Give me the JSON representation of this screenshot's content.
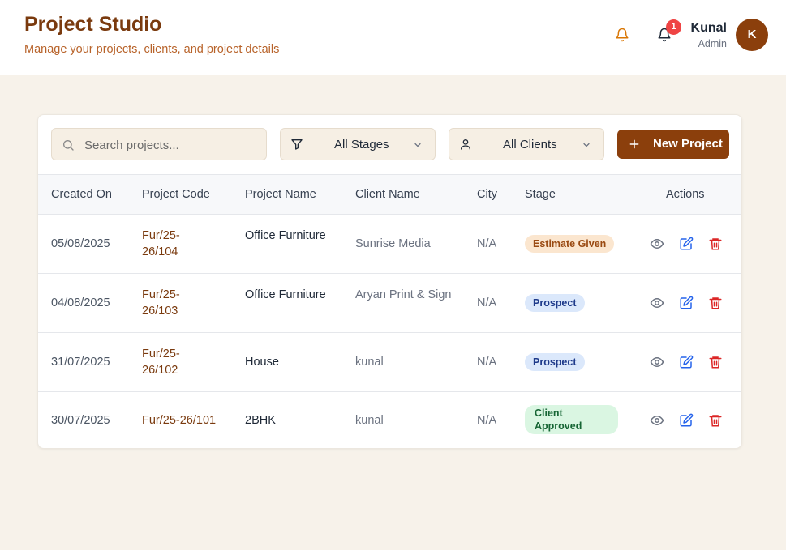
{
  "header": {
    "title": "Project Studio",
    "subtitle": "Manage your projects, clients, and project details",
    "notification_count": "1",
    "user": {
      "name": "Kunal",
      "role": "Admin",
      "initial": "K"
    }
  },
  "toolbar": {
    "search_placeholder": "Search projects...",
    "stage_filter": "All Stages",
    "client_filter": "All Clients",
    "new_project_label": "New Project"
  },
  "table": {
    "columns": [
      "Created On",
      "Project Code",
      "Project Name",
      "Client Name",
      "City",
      "Stage",
      "Actions"
    ],
    "rows": [
      {
        "created": "05/08/2025",
        "code": "Fur/25-26/104",
        "name": "Office Furniture",
        "client": "Sunrise Media",
        "city": "N/A",
        "stage": "Estimate Given"
      },
      {
        "created": "04/08/2025",
        "code": "Fur/25-26/103",
        "name": "Office Furniture",
        "client": "Aryan Print & Sign",
        "city": "N/A",
        "stage": "Prospect"
      },
      {
        "created": "31/07/2025",
        "code": "Fur/25-26/102",
        "name": "House",
        "client": "kunal",
        "city": "N/A",
        "stage": "Prospect"
      },
      {
        "created": "30/07/2025",
        "code": "Fur/25-26/101",
        "name": "2BHK",
        "client": "kunal",
        "city": "N/A",
        "stage": "Client Approved"
      }
    ]
  },
  "colors": {
    "brand": "#8b3f0c",
    "background": "#f7f2ea",
    "stage_estimate": "#fbe6cf",
    "stage_prospect": "#dbe8fb",
    "stage_approved": "#daf6e2"
  },
  "icons": [
    "bell-icon",
    "notification-bell-icon",
    "search-icon",
    "filter-icon",
    "user-icon",
    "chevron-down-icon",
    "plus-icon",
    "eye-icon",
    "edit-icon",
    "trash-icon"
  ]
}
